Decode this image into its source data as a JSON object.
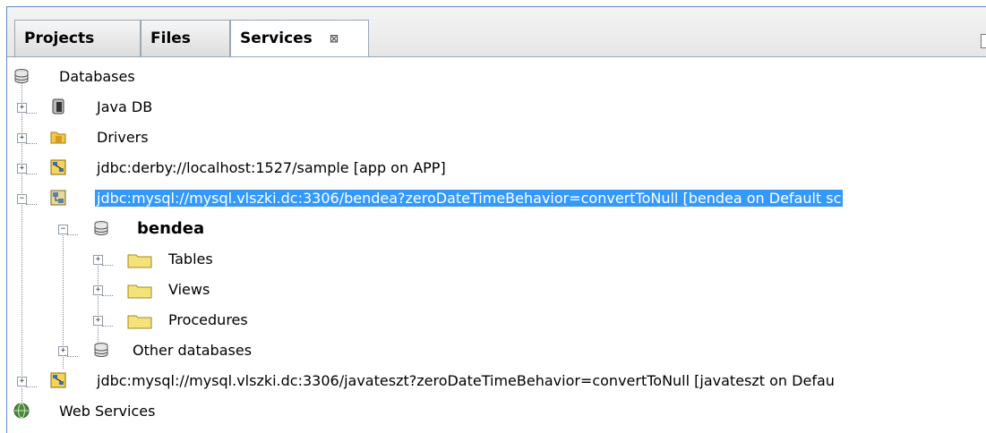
{
  "tabs": [
    {
      "label": "Projects",
      "active": false
    },
    {
      "label": "Files",
      "active": false
    },
    {
      "label": "Services",
      "active": true,
      "close_glyph": "⊠"
    }
  ],
  "tree": {
    "databases": "Databases",
    "java_db": "Java DB",
    "drivers": "Drivers",
    "derby_conn": "jdbc:derby://localhost:1527/sample [app on APP]",
    "mysql_conn1": "jdbc:mysql://mysql.vlszki.dc:3306/bendea?zeroDateTimeBehavior=convertToNull [bendea on Default sc",
    "schema_bendea": "bendea",
    "tables": "Tables",
    "views": "Views",
    "procedures": "Procedures",
    "other_databases": "Other databases",
    "mysql_conn2": "jdbc:mysql://mysql.vlszki.dc:3306/javateszt?zeroDateTimeBehavior=convertToNull [javateszt on Defau",
    "web_services": "Web Services"
  },
  "colors": {
    "selection": "#3399ff",
    "folder": "#f5e27a",
    "border": "#5b8fc7"
  }
}
